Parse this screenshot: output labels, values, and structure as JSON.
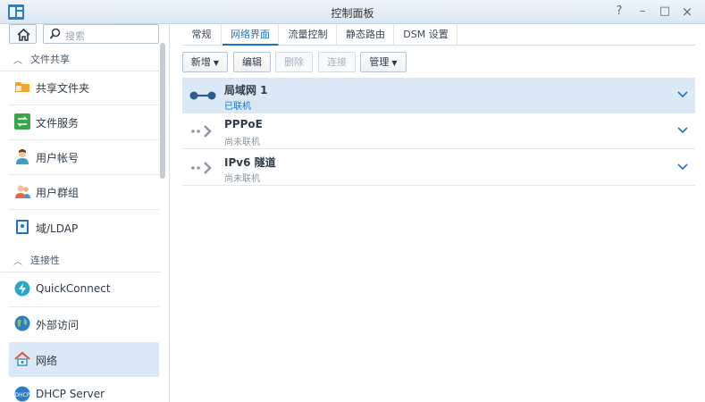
{
  "window": {
    "title": "控制面板",
    "help": "?",
    "minimize": "–",
    "maximize": "□",
    "close": "×"
  },
  "sidebar": {
    "search_placeholder": "搜索",
    "sections": [
      {
        "label": "文件共享"
      },
      {
        "label": "连接性"
      }
    ],
    "items": [
      {
        "label": "共享文件夹"
      },
      {
        "label": "文件服务"
      },
      {
        "label": "用户帐号"
      },
      {
        "label": "用户群组"
      },
      {
        "label": "域/LDAP"
      },
      {
        "label": "QuickConnect"
      },
      {
        "label": "外部访问"
      },
      {
        "label": "网络"
      },
      {
        "label": "DHCP Server"
      }
    ]
  },
  "tabs": [
    {
      "label": "常规"
    },
    {
      "label": "网络界面"
    },
    {
      "label": "流量控制"
    },
    {
      "label": "静态路由"
    },
    {
      "label": "DSM 设置"
    }
  ],
  "toolbar": {
    "create": "新增",
    "edit": "编辑",
    "delete": "删除",
    "connect": "连接",
    "manage": "管理"
  },
  "interfaces": [
    {
      "name": "局域网 1",
      "status": "已联机"
    },
    {
      "name": "PPPoE",
      "status": "尚未联机"
    },
    {
      "name": "IPv6 隧道",
      "status": "尚未联机"
    }
  ],
  "colors": {
    "accent": "#1a73c7",
    "selected_bg": "#dbe9f7"
  }
}
